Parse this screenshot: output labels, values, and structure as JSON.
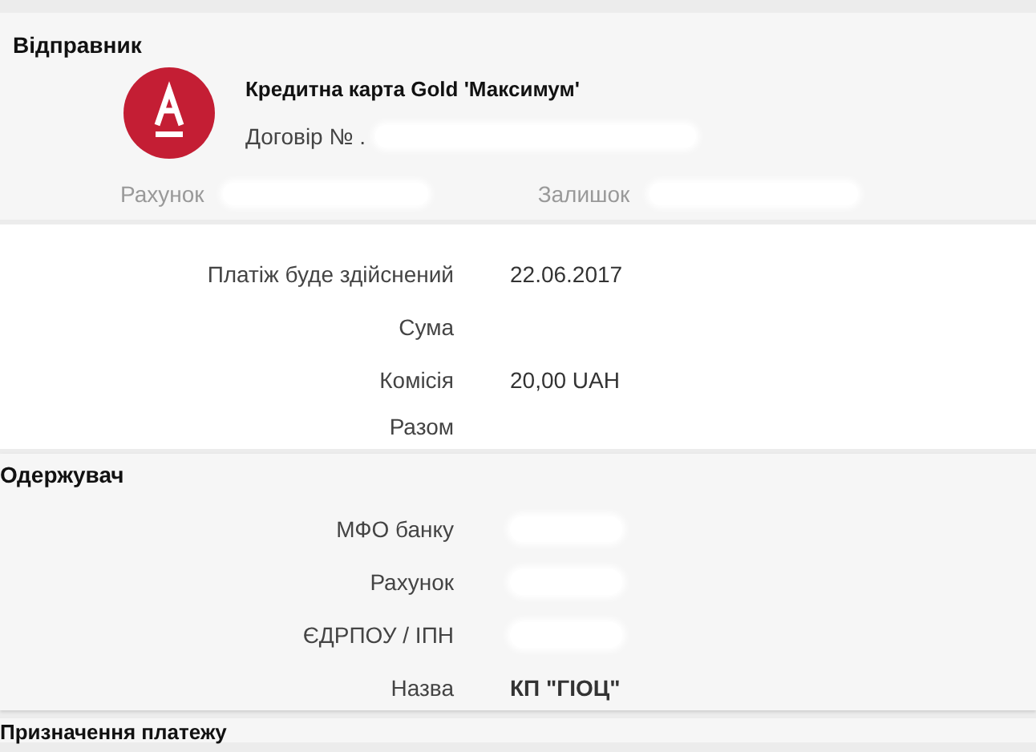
{
  "sender": {
    "heading": "Відправник",
    "card_title": "Кредитна карта Gold 'Максимум'",
    "contract_label": "Договір № .",
    "account_label": "Рахунок",
    "balance_label": "Залишок"
  },
  "payment": [
    {
      "label": "Платіж буде здійснений",
      "value": "22.06.2017"
    },
    {
      "label": "Сума"
    },
    {
      "label": "Комісія",
      "value": "20,00 UAH"
    },
    {
      "label": "Разом"
    }
  ],
  "recipient": {
    "heading": "Одержувач",
    "rows": [
      {
        "label": "МФО банку",
        "kind": "redacted"
      },
      {
        "label": "Рахунок",
        "kind": "redacted"
      },
      {
        "label": "ЄДРПОУ / ІПН",
        "kind": "redacted"
      },
      {
        "label": "Назва",
        "kind": "bold_text",
        "value": "КП \"ГІОЦ\""
      }
    ]
  },
  "purpose": {
    "heading": "Призначення платежу"
  }
}
